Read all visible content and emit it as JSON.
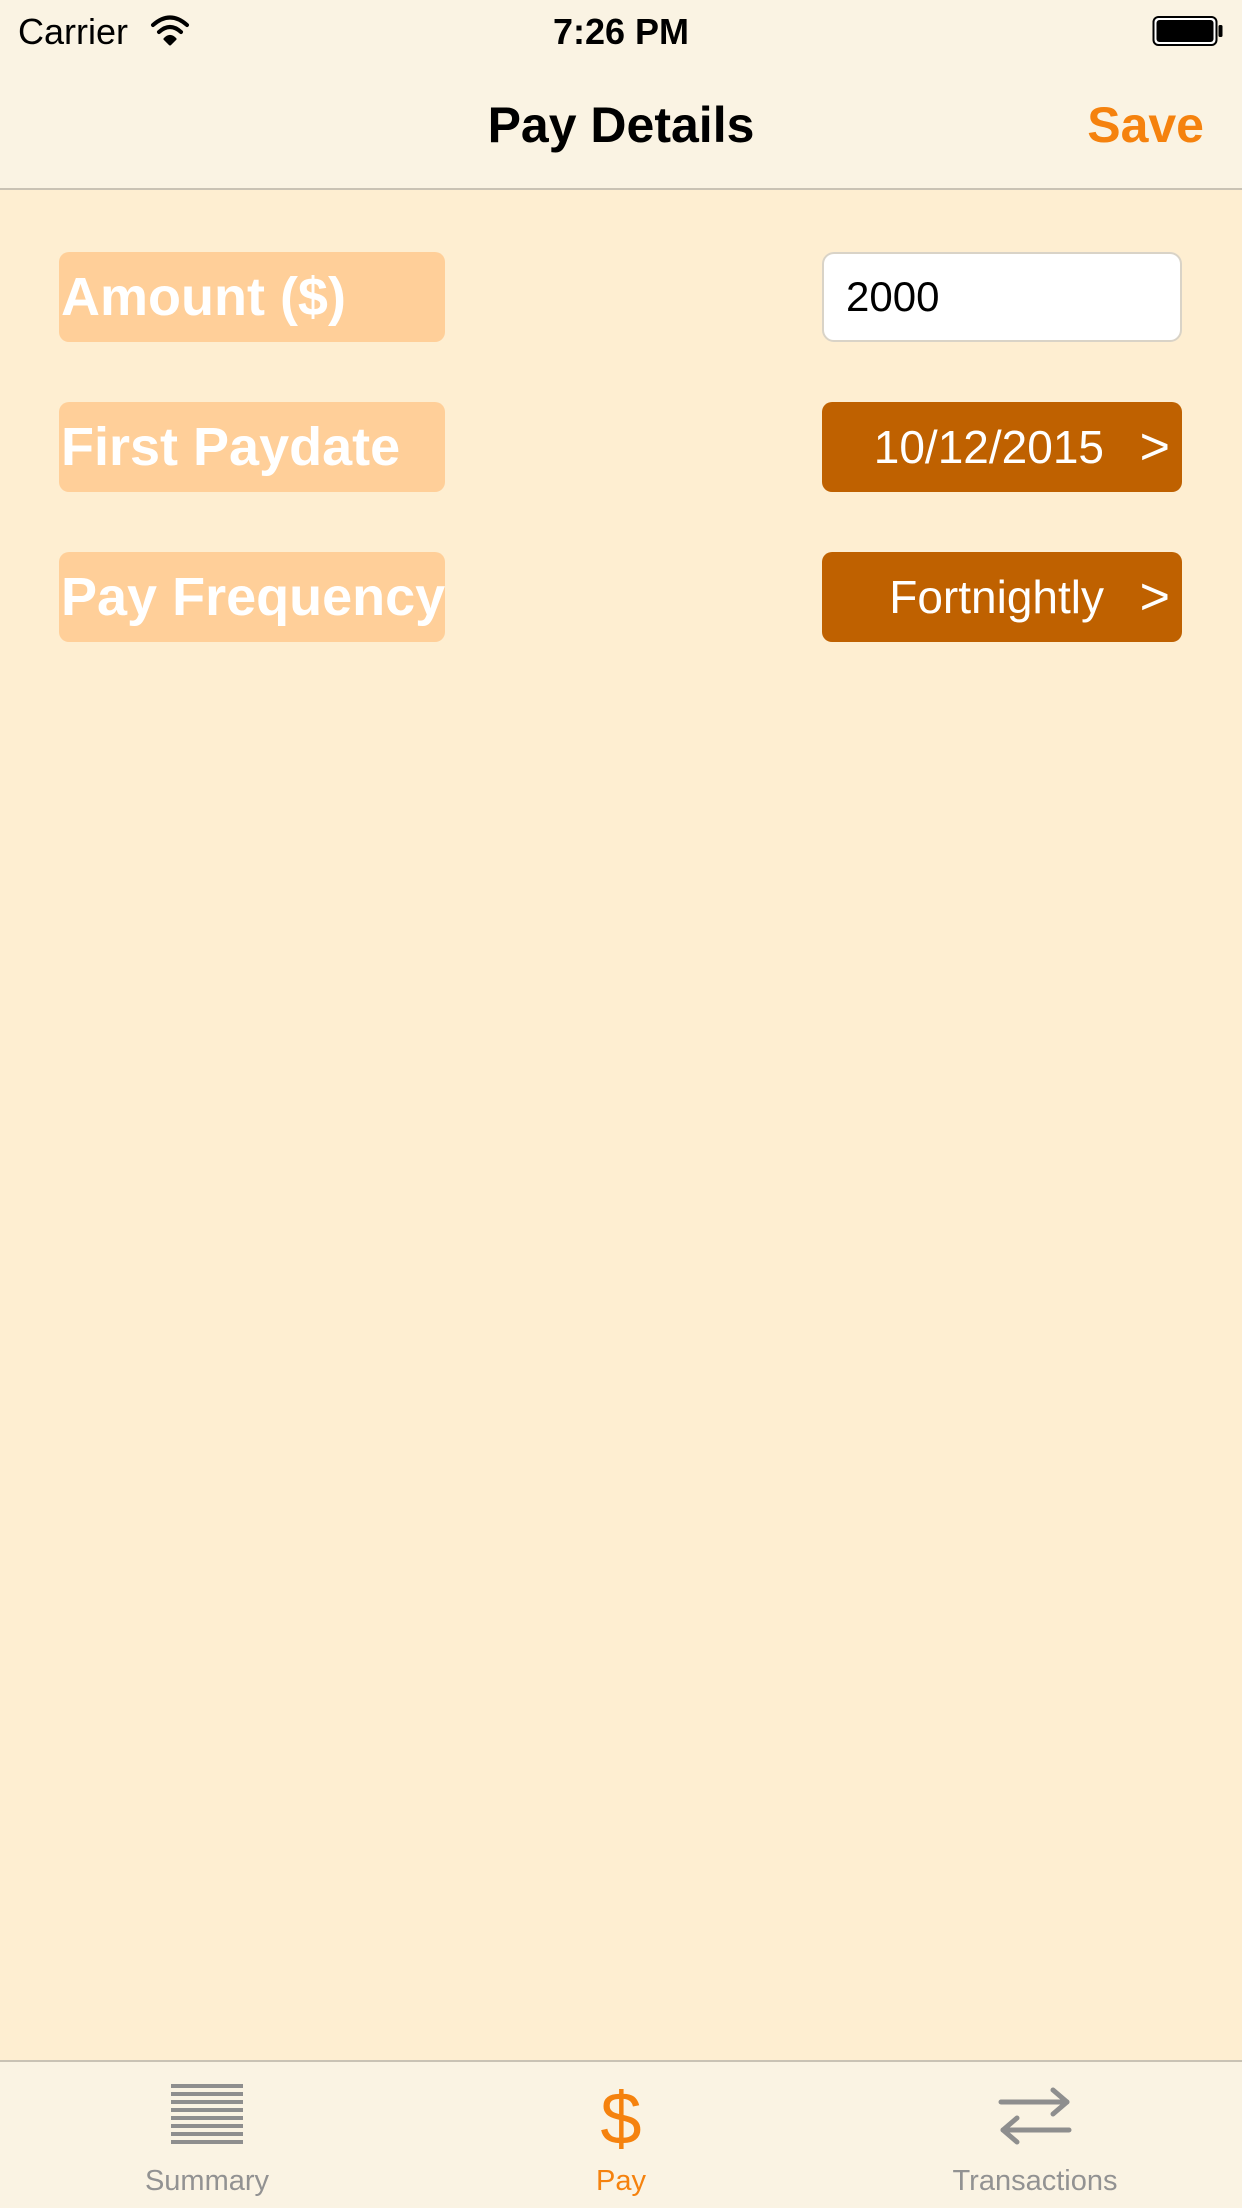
{
  "status_bar": {
    "carrier": "Carrier",
    "time": "7:26 PM",
    "wifi_icon": "wifi-icon",
    "battery_icon": "battery-icon"
  },
  "nav": {
    "title": "Pay Details",
    "save_label": "Save"
  },
  "form": {
    "amount_label": "Amount ($)",
    "amount_value": "2000",
    "first_paydate_label": "First Paydate",
    "first_paydate_value": "10/12/2015",
    "pay_frequency_label": "Pay Frequency",
    "pay_frequency_value": "Fortnightly",
    "chevron": ">"
  },
  "tabs": [
    {
      "label": "Summary",
      "icon": "list-icon",
      "active": false
    },
    {
      "label": "Pay",
      "icon": "dollar-icon",
      "glyph": "$",
      "active": true
    },
    {
      "label": "Transactions",
      "icon": "transfer-arrows-icon",
      "active": false
    }
  ],
  "colors": {
    "background": "#FEEED1",
    "bar_background": "#FAF3E3",
    "accent": "#F5820E",
    "label_box": "#FFCF99",
    "value_button": "#BF6100",
    "tab_inactive": "#929292"
  }
}
